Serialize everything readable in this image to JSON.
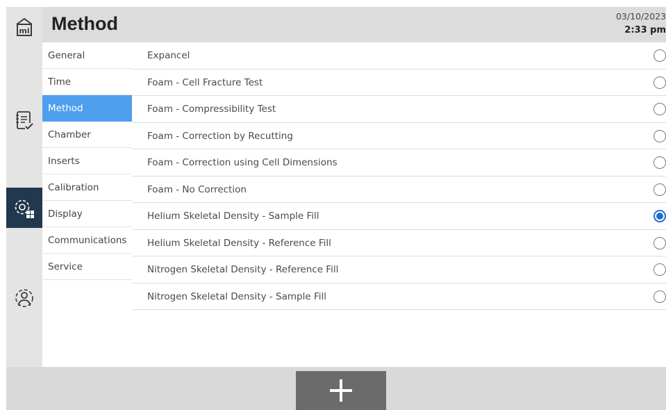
{
  "header": {
    "title": "Method",
    "date": "03/10/2023",
    "time": "2:33 pm"
  },
  "rail": {
    "items": [
      {
        "icon": "home-mi-icon",
        "active": false
      },
      {
        "icon": "document-check-icon",
        "active": false
      },
      {
        "icon": "settings-grid-icon",
        "active": true
      },
      {
        "icon": "user-settings-icon",
        "active": false
      }
    ]
  },
  "subnav": {
    "items": [
      "General",
      "Time",
      "Method",
      "Chamber",
      "Inserts",
      "Calibration",
      "Display",
      "Communications",
      "Service"
    ],
    "active": "Method"
  },
  "methods": {
    "items": [
      {
        "label": "Expancel",
        "selected": false
      },
      {
        "label": "Foam - Cell Fracture Test",
        "selected": false
      },
      {
        "label": "Foam - Compressibility Test",
        "selected": false
      },
      {
        "label": "Foam - Correction by Recutting",
        "selected": false
      },
      {
        "label": "Foam - Correction using Cell Dimensions",
        "selected": false
      },
      {
        "label": "Foam - No Correction",
        "selected": false
      },
      {
        "label": "Helium Skeletal Density - Sample Fill",
        "selected": true
      },
      {
        "label": "Helium Skeletal Density - Reference Fill",
        "selected": false
      },
      {
        "label": "Nitrogen Skeletal Density - Reference Fill",
        "selected": false
      },
      {
        "label": "Nitrogen Skeletal Density - Sample Fill",
        "selected": false
      }
    ]
  },
  "footer": {
    "add_icon": "plus-icon"
  },
  "colors": {
    "accent": "#4f9fef",
    "radio_selected": "#1e6fd0",
    "rail_active": "#22384f"
  }
}
